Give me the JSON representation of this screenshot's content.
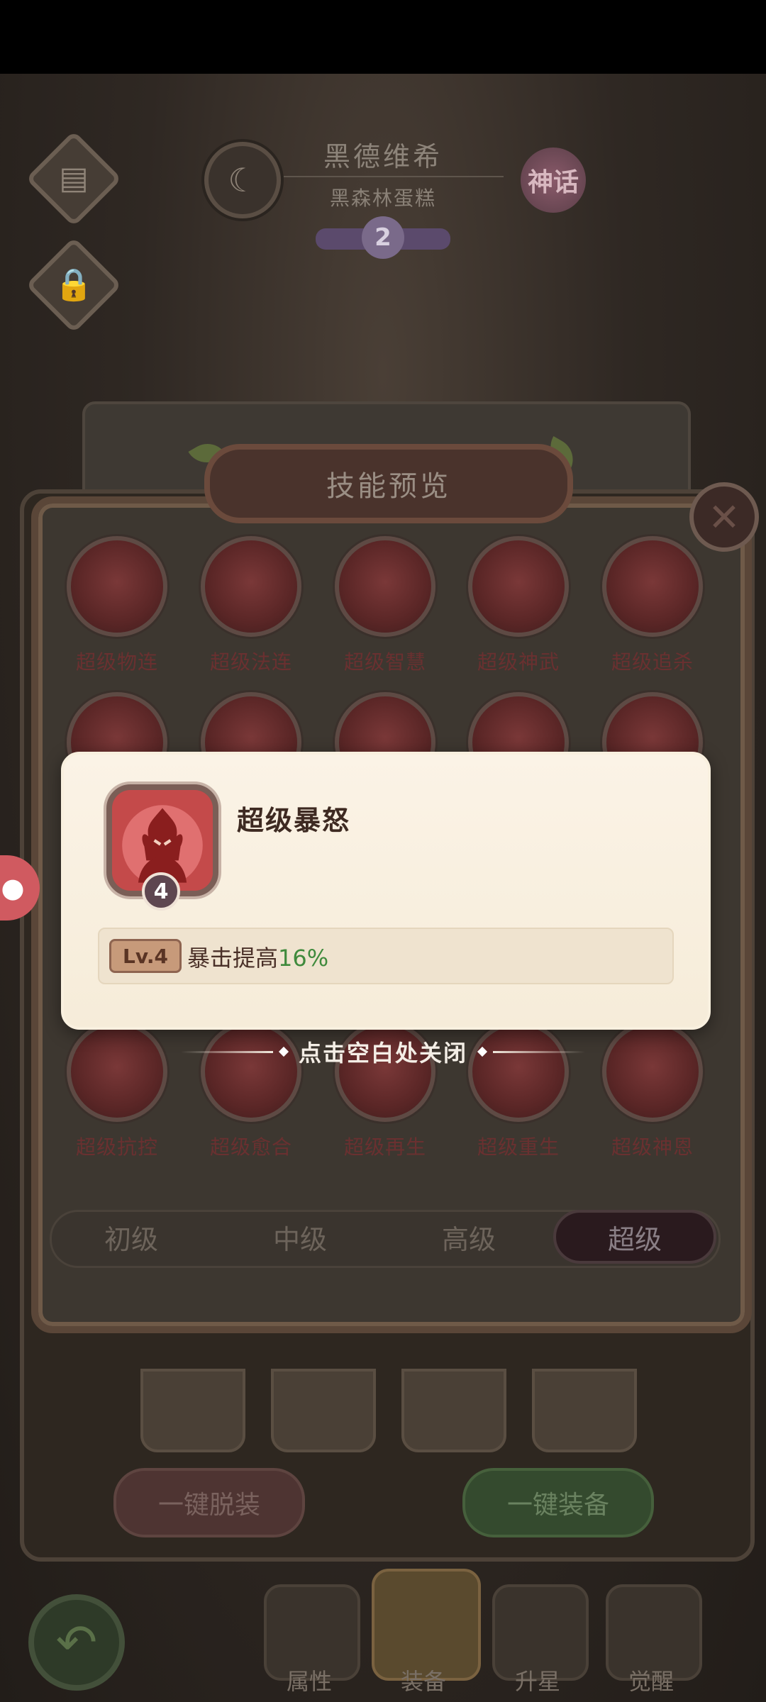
{
  "header": {
    "hero_name": "黑德维希",
    "hero_subtitle": "黑森林蛋糕",
    "rarity_badge": "神话",
    "star_level": "2"
  },
  "skill_panel": {
    "title": "技能预览",
    "close_icon": "close-icon",
    "rows": [
      [
        "超级物连",
        "超级法连",
        "超级智慧",
        "超级神武",
        "超级追杀"
      ],
      [
        "超级抗控",
        "超级愈合",
        "超级再生",
        "超级重生",
        "超级神恩"
      ]
    ],
    "tiers": [
      "初级",
      "中级",
      "高级",
      "超级"
    ],
    "active_tier": "超级"
  },
  "popup": {
    "skill_name": "超级暴怒",
    "skill_level_badge": "4",
    "level_tag": "Lv.4",
    "desc_prefix": "暴击提高",
    "desc_value": "16%"
  },
  "hint": "点击空白处关闭",
  "actions": {
    "unequip": "一键脱装",
    "equip": "一键装备"
  },
  "bottom_nav": [
    "属性",
    "装备",
    "升星",
    "觉醒"
  ],
  "colors": {
    "accent_green": "#3f8a3c",
    "skill_red": "#6a3030",
    "popup_bg": "#fbf3e6"
  }
}
